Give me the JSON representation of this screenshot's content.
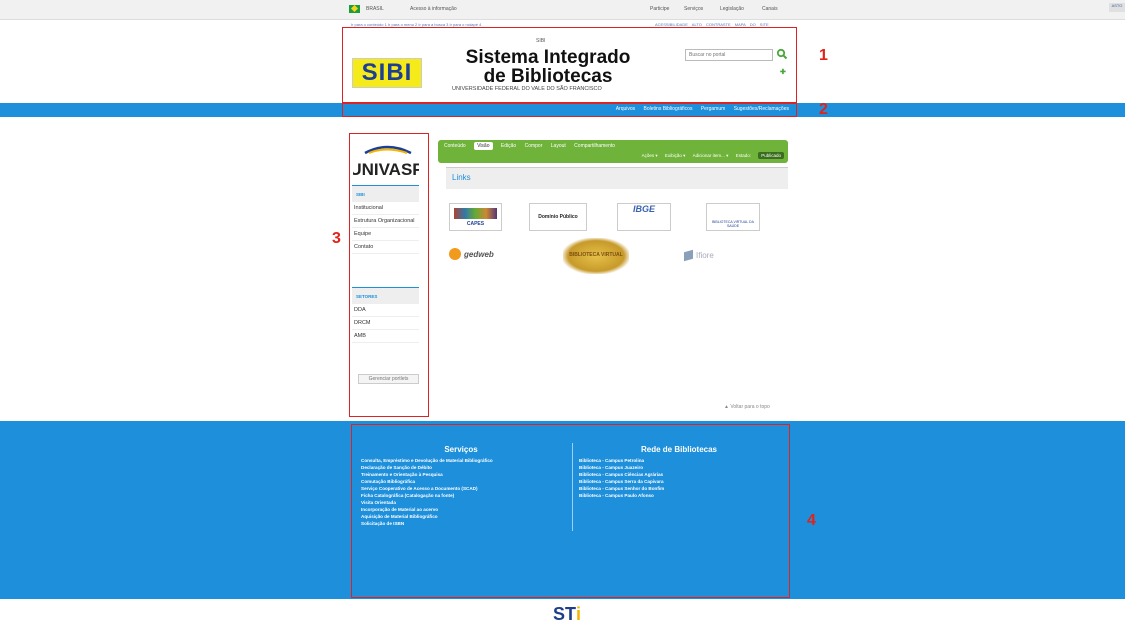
{
  "gov_bar": {
    "country": "BRASIL",
    "info": "Acesso à informação",
    "links": [
      "Participe",
      "Serviços",
      "Legislação",
      "Canais"
    ],
    "right": "ASTO"
  },
  "header": {
    "skip_links": "Ir para o conteúdo 1  Ir para o menu 2  Ir para a busca 3  Ir para o rodapé 4",
    "accessibility_links": "ACESSIBILIDADE ALTO CONTRASTE MAPA DO SITE",
    "sibi_small": "SIBI",
    "logo_text": "SIBI",
    "title": "Sistema Integrado de Bibliotecas",
    "subtitle": "UNIVERSIDADE FEDERAL DO VALE DO SÃO FRANCISCO",
    "search_placeholder": "Buscar no portal"
  },
  "nav": [
    "Arquivos",
    "Boletins Bibliográficos",
    "Pergamum",
    "Sugestões/Reclamações"
  ],
  "annotations": [
    "1",
    "2",
    "3",
    "4"
  ],
  "sidebar": {
    "logo_text": "UNIVASF",
    "sibi_header": "SIBI",
    "sibi_items": [
      "Institucional",
      "Estrutura Organizacional",
      "Equipe",
      "Contato"
    ],
    "setores_header": "SETORES",
    "setores_items": [
      "DDA",
      "DRCM",
      "AMB"
    ],
    "manage": "Gerenciar portlets"
  },
  "editbar": {
    "tabs": [
      "Conteúdo",
      "Visão",
      "Edição",
      "Compor",
      "Layout",
      "Compartilhamento"
    ],
    "active_tab": "Visão",
    "actions": [
      "Ações ▾",
      "Exibição ▾",
      "Adicionar item... ▾",
      "Estado:"
    ],
    "state": "Publicado"
  },
  "content": {
    "title": "Links",
    "links": [
      "CAPES",
      "Domínio Público",
      "IBGE",
      "BIBLIOTECA VIRTUAL DA SAÚDE",
      "gedweb",
      "BIBLIOTECA VIRTUAL",
      "Ifiore"
    ],
    "back_to_top": "▲ Voltar para o topo"
  },
  "footer": {
    "services_title": "Serviços",
    "services": [
      "Consulta, Empréstimo e Devolução de Material Bibliográfico",
      "Declaração de Sanção de Débito",
      "Treinamento e Orientação à Pesquisa",
      "Comutação Bibliográfica",
      "Serviço Cooperativo de Acesso a Documento (SCAD)",
      "Ficha Catalográfica (Catalogação na fonte)",
      "Visita Orientada",
      "Incorporação de Material ao acervo",
      "Aquisição de Material Bibliográfico",
      "Solicitação de ISBN"
    ],
    "network_title": "Rede de Bibliotecas",
    "network": [
      "Biblioteca - Campus Petrolina",
      "Biblioteca - Campus Juazeiro",
      "Biblioteca - Campus Ciências Agrárias",
      "Biblioteca - Campus Serra da Capivara",
      "Biblioteca - Campus Senhor do Bonfim",
      "Biblioteca - Campus Paulo Afonso"
    ]
  },
  "bottom_logo": {
    "st": "ST",
    "i": "i"
  }
}
